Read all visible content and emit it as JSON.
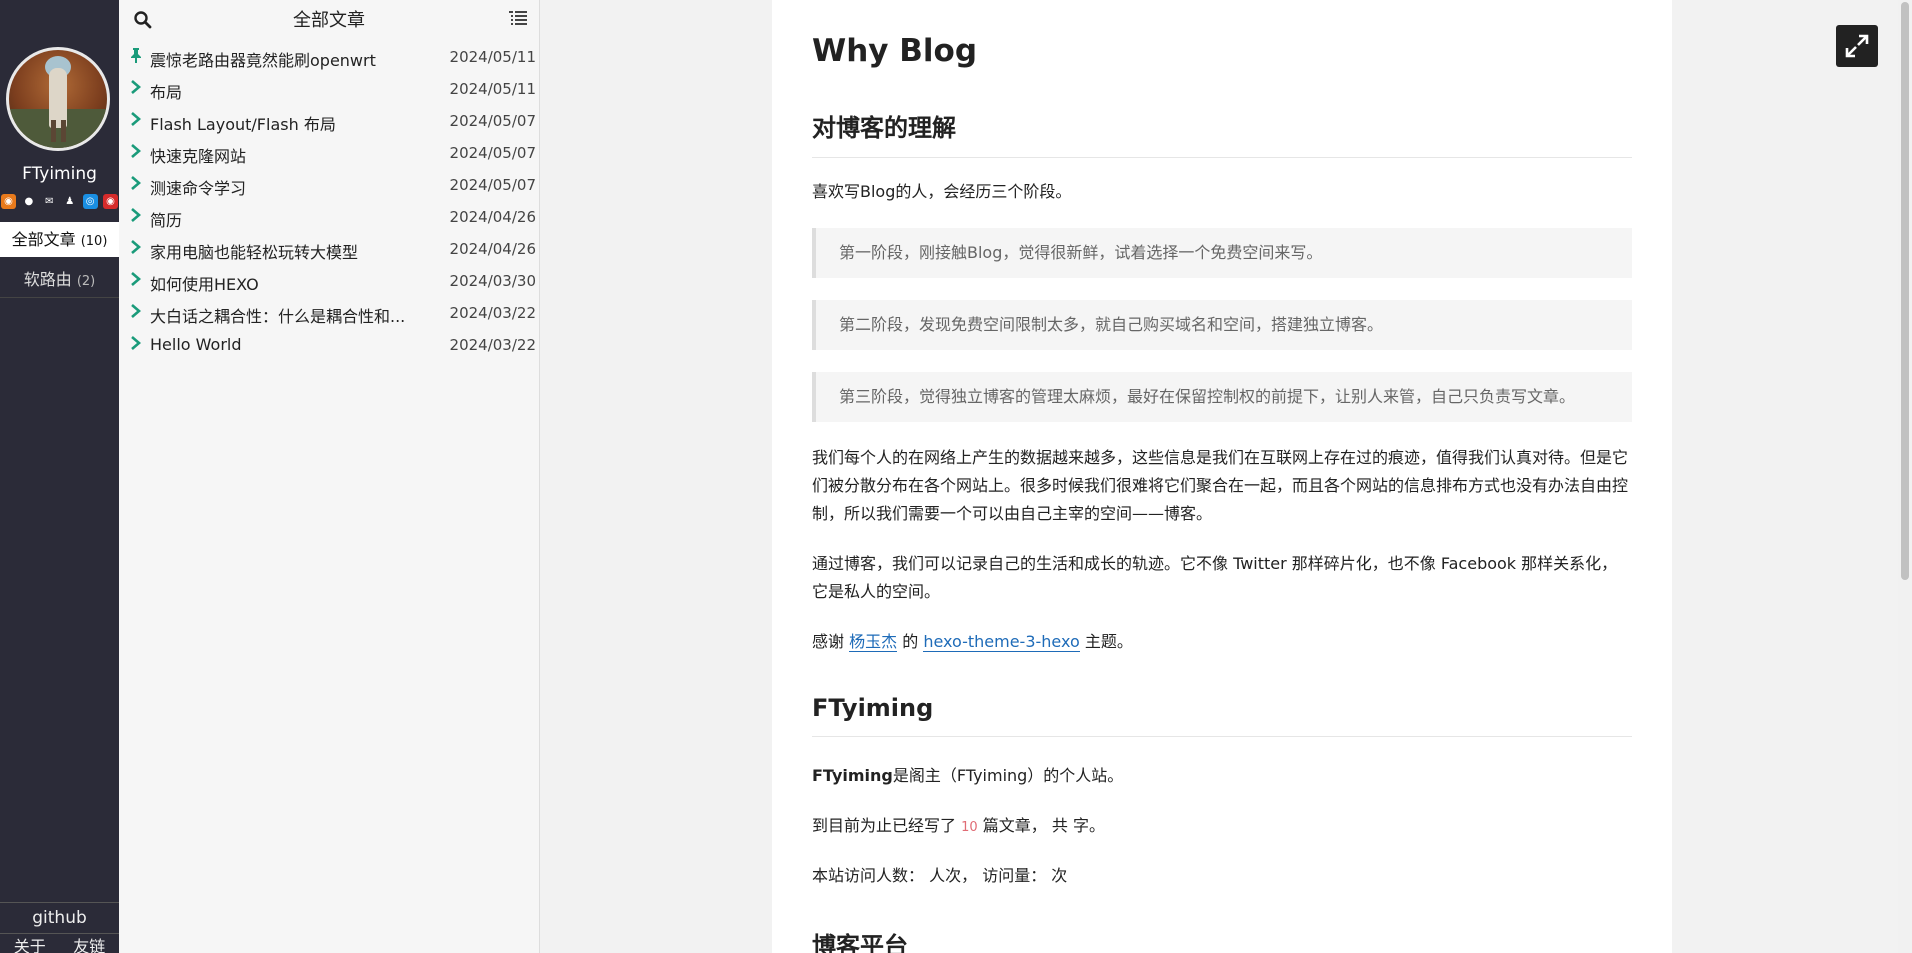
{
  "sidebar": {
    "author": "FTyiming",
    "social_icons": [
      {
        "name": "rss-icon",
        "color": "#e87a1c",
        "glyph": "◉"
      },
      {
        "name": "github-icon",
        "color": "#2b2b38",
        "glyph": "●"
      },
      {
        "name": "mail-icon",
        "color": "#2b2b38",
        "glyph": "✉"
      },
      {
        "name": "qq-icon",
        "color": "#2b2b38",
        "glyph": "♟"
      },
      {
        "name": "link-icon",
        "color": "#1a8fe3",
        "glyph": "◎"
      },
      {
        "name": "weibo-icon",
        "color": "#d62b2b",
        "glyph": "◉"
      }
    ],
    "nav": [
      {
        "label": "全部文章",
        "count": "(10)"
      },
      {
        "label": "软路由",
        "count": "(2)"
      }
    ],
    "github": "github",
    "bottom_links": [
      "关于",
      "友链"
    ]
  },
  "list": {
    "title": "全部文章",
    "articles": [
      {
        "title": "震惊老路由器竟然能刷openwrt",
        "date": "2024/05/11",
        "pinned": true
      },
      {
        "title": "布局",
        "date": "2024/05/11",
        "pinned": false
      },
      {
        "title": "Flash Layout/Flash 布局",
        "date": "2024/05/07",
        "pinned": false
      },
      {
        "title": "快速克隆网站",
        "date": "2024/05/07",
        "pinned": false
      },
      {
        "title": "测速命令学习",
        "date": "2024/05/07",
        "pinned": false
      },
      {
        "title": "简历",
        "date": "2024/04/26",
        "pinned": false
      },
      {
        "title": "家用电脑也能轻松玩转大模型",
        "date": "2024/04/26",
        "pinned": false
      },
      {
        "title": "如何使用HEXO",
        "date": "2024/03/30",
        "pinned": false
      },
      {
        "title": "大白话之耦合性：什么是耦合性和...",
        "date": "2024/03/22",
        "pinned": false
      },
      {
        "title": "Hello World",
        "date": "2024/03/22",
        "pinned": false
      }
    ],
    "accent_color": "#1a9b7a"
  },
  "content": {
    "title": "Why Blog",
    "section1_heading": "对博客的理解",
    "intro": "喜欢写Blog的人，会经历三个阶段。",
    "quotes": [
      "第一阶段，刚接触Blog，觉得很新鲜，试着选择一个免费空间来写。",
      "第二阶段，发现免费空间限制太多，就自己购买域名和空间，搭建独立博客。",
      "第三阶段，觉得独立博客的管理太麻烦，最好在保留控制权的前提下，让别人来管，自己只负责写文章。"
    ],
    "para1": "我们每个人的在网络上产生的数据越来越多，这些信息是我们在互联网上存在过的痕迹，值得我们认真对待。但是它们被分散分布在各个网站上。很多时候我们很难将它们聚合在一起，而且各个网站的信息排布方式也没有办法自由控制，所以我们需要一个可以由自己主宰的空间——博客。",
    "para2": "通过博客，我们可以记录自己的生活和成长的轨迹。它不像 Twitter 那样碎片化，也不像 Facebook 那样关系化，它是私人的空间。",
    "thanks_prefix": "感谢",
    "thanks_link1": "杨玉杰",
    "thanks_mid": "的",
    "thanks_link2": "hexo-theme-3-hexo",
    "thanks_suffix": "主题。",
    "section2_heading": "FTyiming",
    "site_bold": "FTyiming",
    "site_desc": "是阁主（FTyiming）的个人站。",
    "stats_prefix": "到目前为止已经写了",
    "stats_count": "10",
    "stats_mid": "篇文章，  共",
    "stats_suffix": "字。",
    "visits_prefix": "本站访问人数：",
    "visits_mid": "人次，  访问量：",
    "visits_suffix": "次",
    "section3_heading": "博客平台"
  }
}
